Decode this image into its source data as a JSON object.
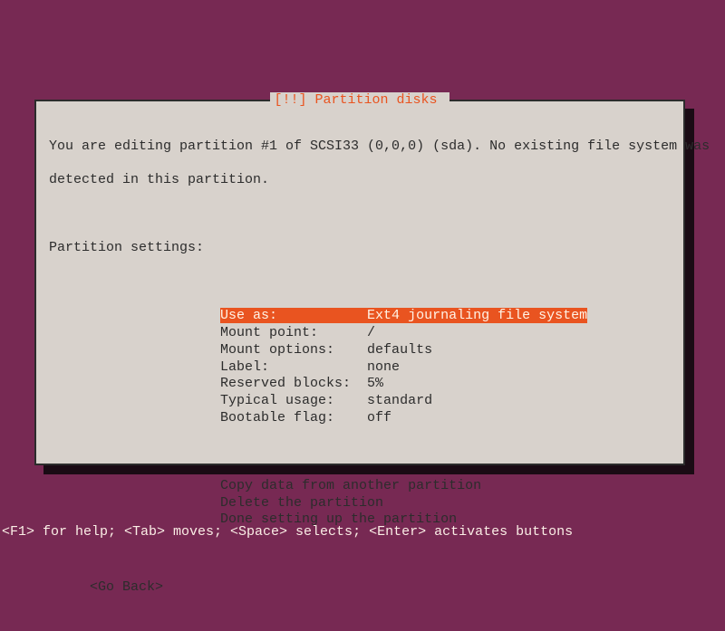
{
  "dialog": {
    "title_marker": "[!!]",
    "title_text": "Partition disks",
    "intro_line1": "You are editing partition #1 of SCSI33 (0,0,0) (sda). No existing file system was",
    "intro_line2": "detected in this partition.",
    "settings_heading": "Partition settings:",
    "settings": [
      {
        "label": "Use as:",
        "value": "Ext4 journaling file system",
        "selected": true
      },
      {
        "label": "Mount point:",
        "value": "/"
      },
      {
        "label": "Mount options:",
        "value": "defaults"
      },
      {
        "label": "Label:",
        "value": "none"
      },
      {
        "label": "Reserved blocks:",
        "value": "5%"
      },
      {
        "label": "Typical usage:",
        "value": "standard"
      },
      {
        "label": "Bootable flag:",
        "value": "off"
      }
    ],
    "actions": [
      "Copy data from another partition",
      "Delete the partition",
      "Done setting up the partition"
    ],
    "go_back": "<Go Back>"
  },
  "footer": "<F1> for help; <Tab> moves; <Space> selects; <Enter> activates buttons"
}
